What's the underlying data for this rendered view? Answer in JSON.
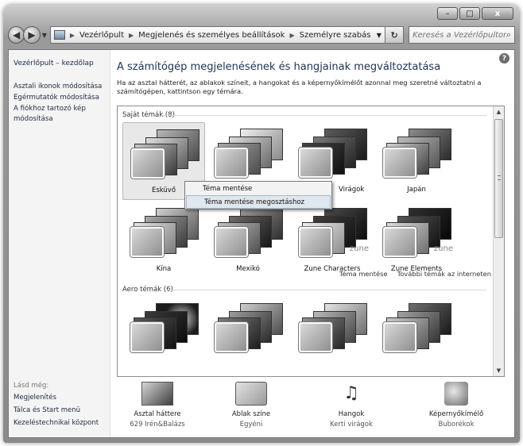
{
  "window": {
    "minimize": "–",
    "maximize": "□",
    "close": "x"
  },
  "address": {
    "crumbs": [
      "Vezérlőpult",
      "Megjelenés és személyes beállítások",
      "Személyre szabás"
    ],
    "search_placeholder": "Keresés a Vezérlőpulton"
  },
  "sidebar": {
    "home": "Vezérlőpult – kezdőlap",
    "links": [
      "Asztali ikonok módosítása",
      "Egérmutatók módosítása",
      "A fiókhoz tartozó kép módosítása"
    ],
    "seealso_title": "Lásd még:",
    "seealso_links": [
      "Megjelenítés",
      "Tálca és Start menü",
      "Kezeléstechnikai központ"
    ]
  },
  "main": {
    "title": "A számítógép megjelenésének és hangjainak megváltoztatása",
    "description": "Ha az asztal hátterét, az ablakok színeit, a hangokat és a képernyőkímélőt azonnal meg szeretné változtatni a számítógépen, kattintson egy témára.",
    "my_themes_label": "Saját témák (8)",
    "aero_themes_label": "Aero témák (6)",
    "themes": [
      "Esküvő",
      "",
      "Virágok",
      "Japán",
      "Kína",
      "Mexikó",
      "Zune Characters",
      "Zune Elements"
    ],
    "zune_mark": "zune",
    "save_theme": "Téma mentése",
    "more_themes": "További témák az interneten"
  },
  "context_menu": {
    "items": [
      "Téma mentése",
      "Téma mentése megosztáshoz"
    ]
  },
  "bottom": {
    "items": [
      {
        "label": "Asztal háttere",
        "value": "629 Irén&Balázs"
      },
      {
        "label": "Ablak színe",
        "value": "Egyéni"
      },
      {
        "label": "Hangok",
        "value": "Kerti virágok"
      },
      {
        "label": "Képernyőkímélő",
        "value": "Buborékok"
      }
    ]
  },
  "colors": {
    "title": "#1e3158",
    "link": "#1c2a44",
    "hover": "#dfe7ef"
  }
}
